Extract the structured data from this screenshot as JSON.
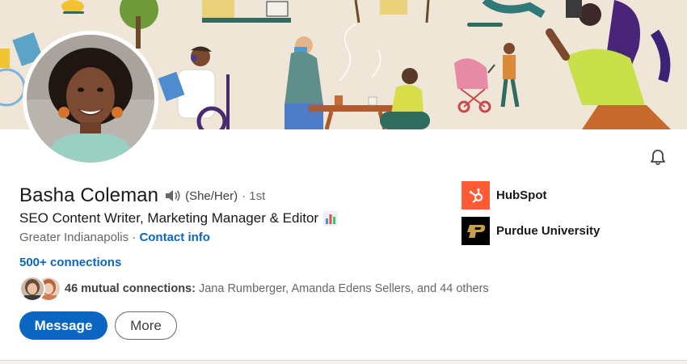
{
  "profile": {
    "name": "Basha Coleman",
    "pronouns": "(She/Her)",
    "degree": "· 1st",
    "headline": "SEO Content Writer, Marketing Manager & Editor",
    "location": "Greater Indianapolis",
    "location_separator": " · ",
    "contact_info_label": "Contact info",
    "connections_label": "500+ connections"
  },
  "mutual": {
    "count_label": "46 mutual connections:",
    "names_label": " Jana Rumberger, Amanda Edens Sellers, and 44 others"
  },
  "actions": {
    "message_label": "Message",
    "more_label": "More"
  },
  "organizations": [
    {
      "name": "HubSpot",
      "logo_color": "#ff5c35"
    },
    {
      "name": "Purdue University",
      "logo_color": "#000000"
    }
  ],
  "icons": {
    "bell": "bell-icon",
    "speaker": "speaker-icon",
    "chart_emoji": "bar-chart-emoji"
  },
  "colors": {
    "brand_blue": "#0a66c2",
    "banner_bg": "#efe6d8"
  }
}
